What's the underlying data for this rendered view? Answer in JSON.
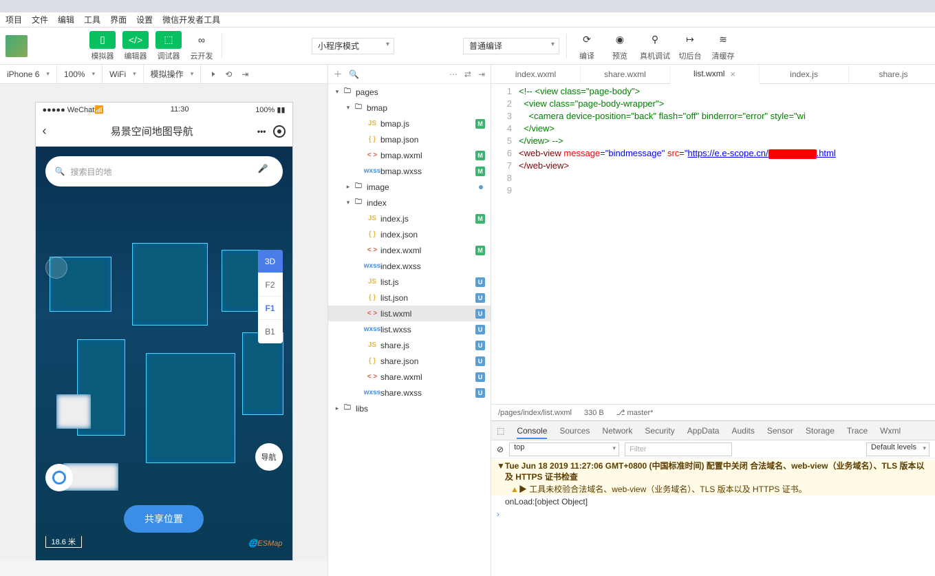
{
  "menubar": [
    "项目",
    "文件",
    "编辑",
    "工具",
    "界面",
    "设置",
    "微信开发者工具"
  ],
  "toolbar": {
    "buttons": {
      "simulator": "模拟器",
      "editor": "编辑器",
      "debugger": "调试器",
      "cloud": "云开发"
    },
    "mode_select": "小程序模式",
    "compile_select": "普通编译",
    "right_buttons": {
      "compile": "编译",
      "preview": "预览",
      "remote": "真机调试",
      "background": "切后台",
      "clear_cache": "清缓存"
    }
  },
  "secbar": {
    "device": "iPhone 6",
    "zoom": "100%",
    "network": "WiFi",
    "sim_action": "模拟操作"
  },
  "phone": {
    "carrier": "●●●●● WeChat",
    "time": "11:30",
    "battery": "100%",
    "title": "易景空间地图导航",
    "search_placeholder": "搜索目的地",
    "floors": [
      "3D",
      "F2",
      "F1",
      "B1"
    ],
    "active_floor": "F1",
    "nav_btn": "导航",
    "share_btn": "共享位置",
    "scale": "18.6 米",
    "map_logo": "ESMap"
  },
  "tree": {
    "root": "pages",
    "folders": [
      {
        "name": "bmap",
        "open": true,
        "files": [
          {
            "name": "bmap.js",
            "type": "js",
            "badge": "M"
          },
          {
            "name": "bmap.json",
            "type": "json"
          },
          {
            "name": "bmap.wxml",
            "type": "wxml",
            "badge": "M"
          },
          {
            "name": "bmap.wxss",
            "type": "wxss",
            "badge": "M"
          }
        ]
      },
      {
        "name": "image",
        "open": false,
        "dot": true
      },
      {
        "name": "index",
        "open": true,
        "files": [
          {
            "name": "index.js",
            "type": "js",
            "badge": "M"
          },
          {
            "name": "index.json",
            "type": "json"
          },
          {
            "name": "index.wxml",
            "type": "wxml",
            "badge": "M"
          },
          {
            "name": "index.wxss",
            "type": "wxss"
          },
          {
            "name": "list.js",
            "type": "js",
            "badge": "U"
          },
          {
            "name": "list.json",
            "type": "json",
            "badge": "U"
          },
          {
            "name": "list.wxml",
            "type": "wxml",
            "badge": "U",
            "selected": true
          },
          {
            "name": "list.wxss",
            "type": "wxss",
            "badge": "U"
          },
          {
            "name": "share.js",
            "type": "js",
            "badge": "U"
          },
          {
            "name": "share.json",
            "type": "json",
            "badge": "U"
          },
          {
            "name": "share.wxml",
            "type": "wxml",
            "badge": "U"
          },
          {
            "name": "share.wxss",
            "type": "wxss",
            "badge": "U"
          }
        ]
      }
    ],
    "libs": "libs"
  },
  "editor": {
    "tabs": [
      "index.wxml",
      "share.wxml",
      "list.wxml",
      "index.js",
      "share.js"
    ],
    "active_tab": "list.wxml",
    "status": {
      "path": "/pages/index/list.wxml",
      "size": "330 B",
      "branch": "master*"
    },
    "code_lines": [
      "1",
      "2",
      "3",
      "4",
      "5",
      "6",
      "7",
      "8",
      "9"
    ],
    "code": {
      "l1": "<!-- <view class=\"page-body\">",
      "l2": "  <view class=\"page-body-wrapper\">",
      "l3": "    <camera device-position=\"back\" flash=\"off\" binderror=\"error\" style=\"wi",
      "l4": "  </view>",
      "l5": "</view> -->",
      "l6_pre": "<",
      "l6_tag": "web-view",
      "l6_sp": " ",
      "l6_attr": "message",
      "l6_eq": "=",
      "l6_v1": "\"bindmessage\"",
      "l6_sp2": " ",
      "l6_attr2": "src",
      "l6_eq2": "=",
      "l6_v2a": "\"",
      "l6_url": "https://e.e-scope.cn/",
      "l6_v2b": ".html",
      "l6_close": "",
      "l7_pre": "</",
      "l7_tag": "web-view",
      "l7_close": ">"
    }
  },
  "devtools": {
    "tabs": [
      "Console",
      "Sources",
      "Network",
      "Security",
      "AppData",
      "Audits",
      "Sensor",
      "Storage",
      "Trace",
      "Wxml"
    ],
    "active": "Console",
    "toolbar": {
      "context": "top",
      "filter_placeholder": "Filter",
      "levels": "Default levels"
    },
    "lines": [
      {
        "type": "warn",
        "text": "Tue Jun 18 2019 11:27:06 GMT+0800 (中国标准时间) 配置中关闭 合法域名、web-view（业务域名）、TLS 版本以及 HTTPS 证书检查"
      },
      {
        "type": "warn2",
        "text": "▶ 工具未校验合法域名、web-view（业务域名）、TLS 版本以及 HTTPS 证书。"
      },
      {
        "type": "log",
        "text": "onLoad:[object Object]"
      }
    ]
  }
}
